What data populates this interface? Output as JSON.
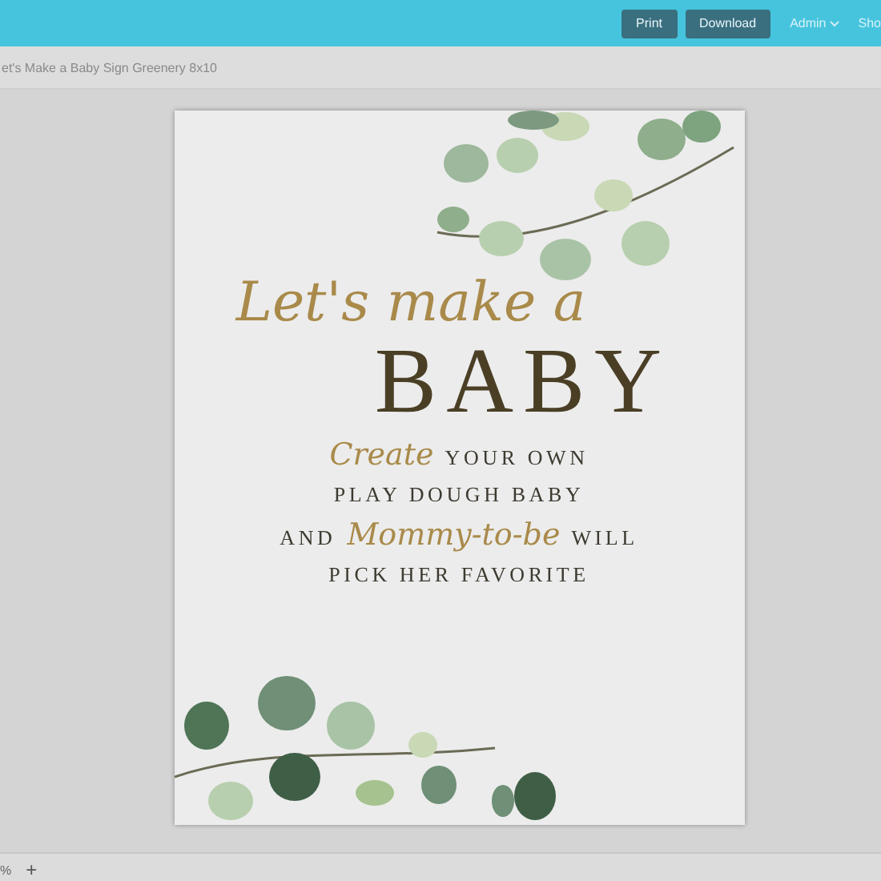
{
  "top_bar": {
    "buttons": [
      "Print",
      "Download"
    ],
    "menus": [
      {
        "label": "Admin",
        "dropdown": true
      },
      {
        "label": "Sho",
        "dropdown": false
      }
    ]
  },
  "document_title": "et's Make a Baby Sign Greenery 8x10",
  "sign": {
    "lines": [
      {
        "kind": "script-large",
        "segments": [
          {
            "kind": "script",
            "text": "Let's make a"
          }
        ]
      },
      {
        "kind": "title",
        "segments": [
          {
            "kind": "title",
            "text": "BABY"
          }
        ]
      },
      {
        "kind": "body",
        "segments": [
          {
            "kind": "script",
            "text": "Create"
          },
          {
            "kind": "caps",
            "text": "YOUR OWN"
          }
        ]
      },
      {
        "kind": "body",
        "segments": [
          {
            "kind": "caps",
            "text": "PLAY DOUGH BABY"
          }
        ]
      },
      {
        "kind": "body",
        "segments": [
          {
            "kind": "caps",
            "text": "AND"
          },
          {
            "kind": "script",
            "text": "Mommy-to-be"
          },
          {
            "kind": "caps",
            "text": "WILL"
          }
        ]
      },
      {
        "kind": "body",
        "segments": [
          {
            "kind": "caps",
            "text": "PICK HER FAVORITE"
          }
        ]
      }
    ]
  },
  "bottom_bar": {
    "zoom": "%",
    "add": "+"
  }
}
